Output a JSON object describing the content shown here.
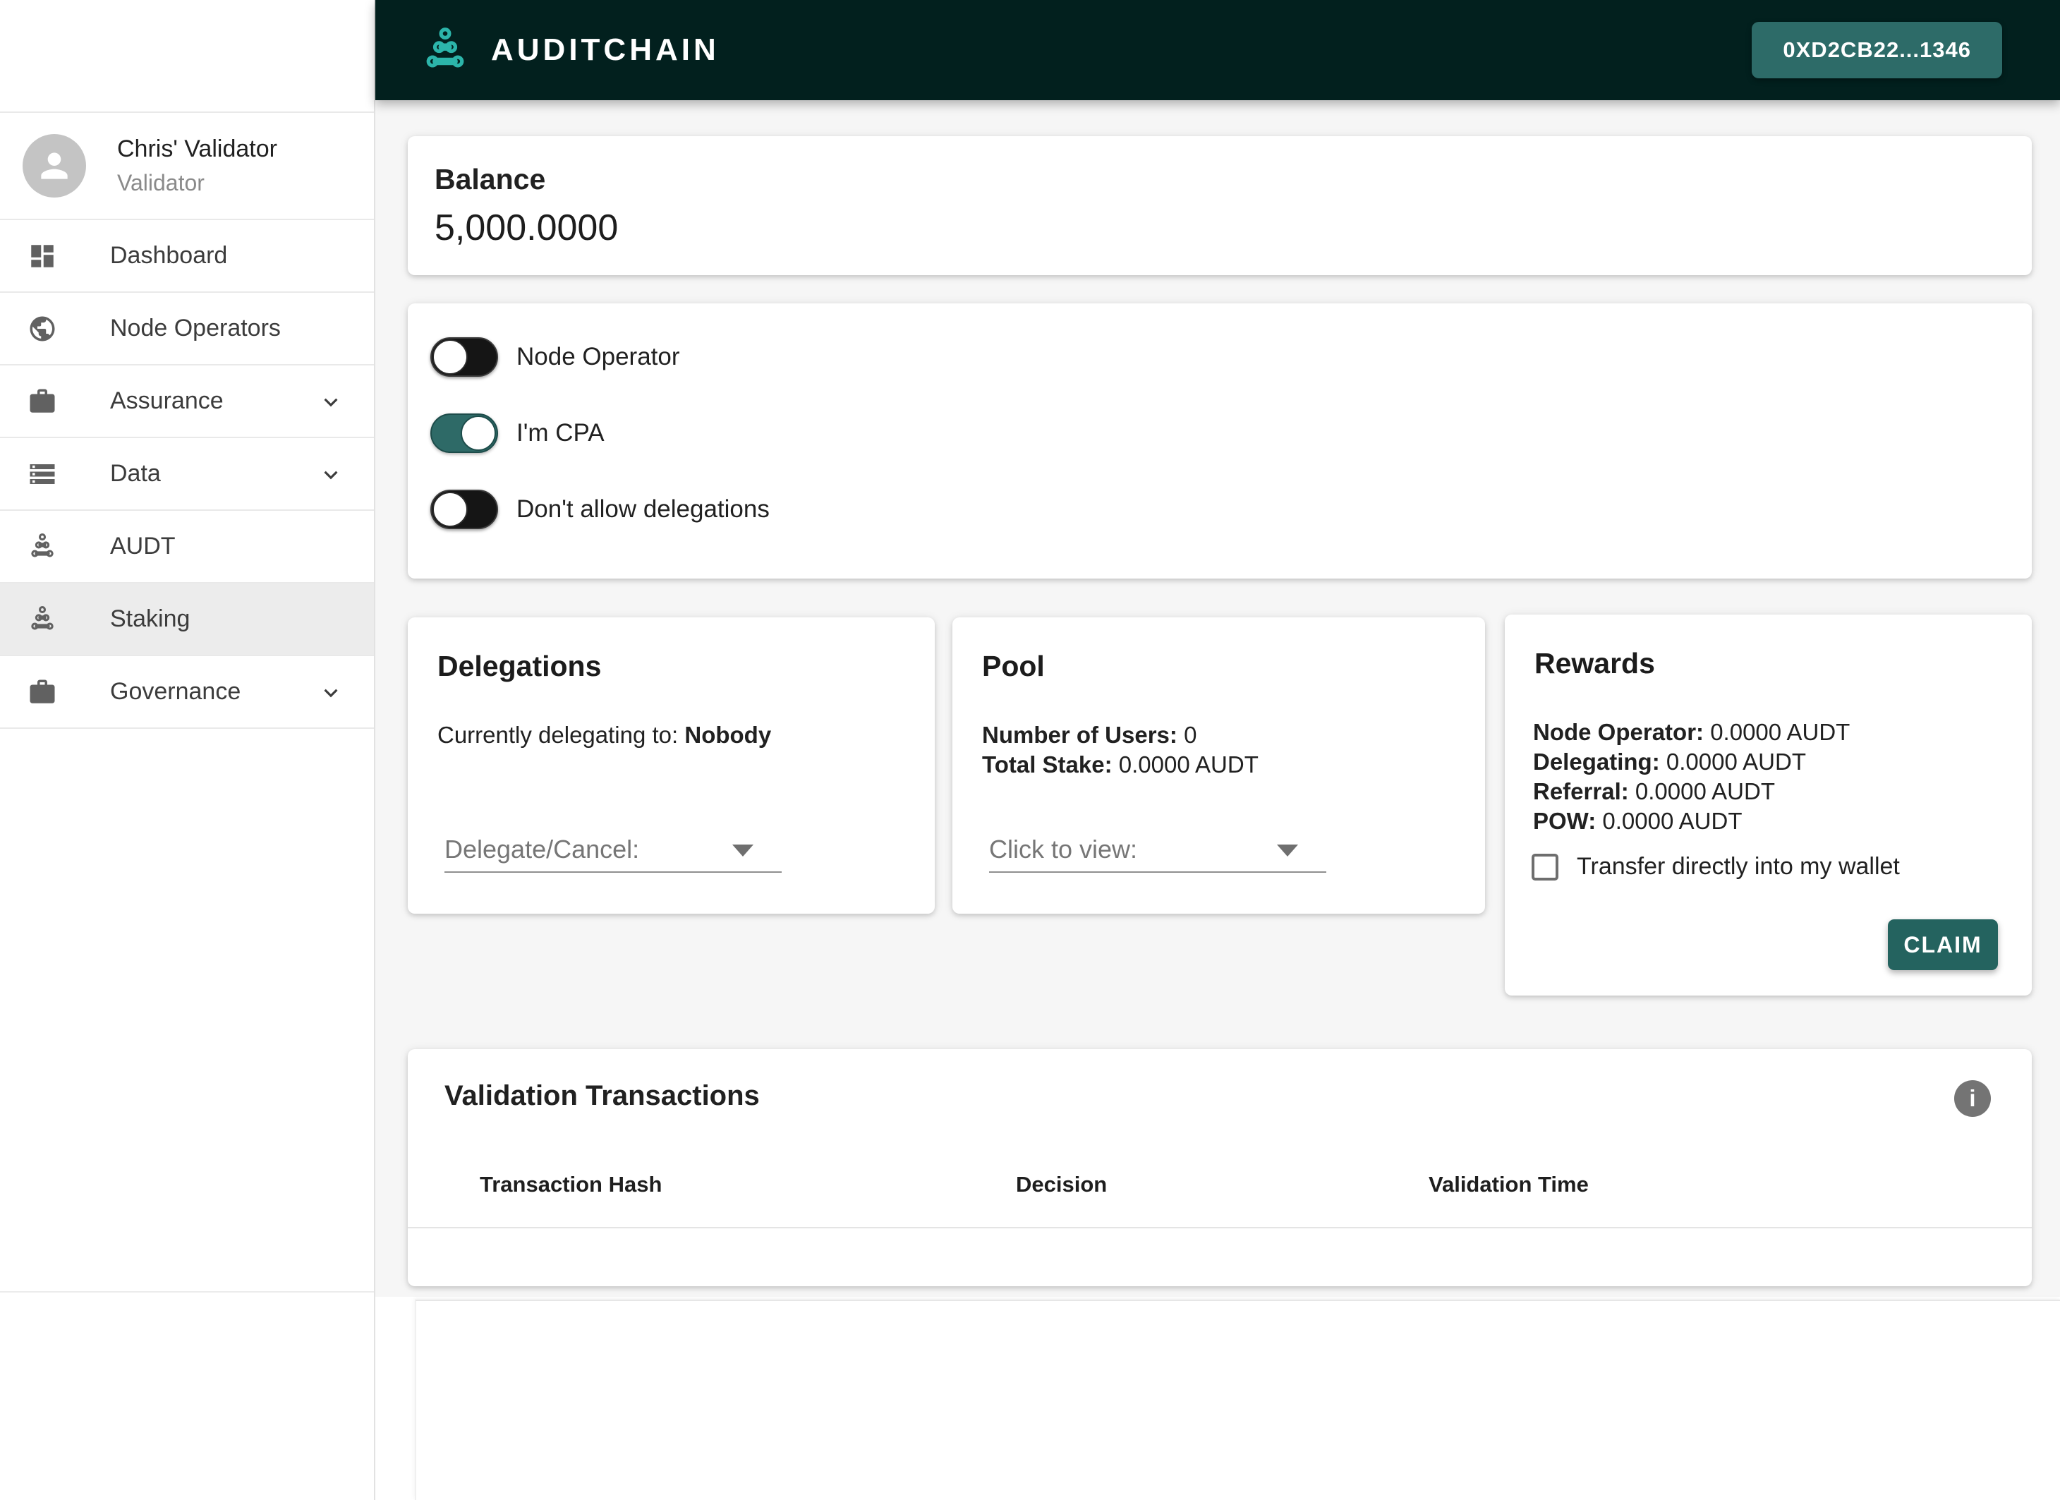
{
  "header": {
    "brand": "AUDITCHAIN",
    "wallet_button_label": "0XD2CB22...1346",
    "logo_icon": "auditchain-logo-icon",
    "colors": {
      "header_bg": "#02201e",
      "logo_teal": "#2cb5aa",
      "wallet_button": "#2d6b68"
    }
  },
  "sidebar": {
    "profile": {
      "name": "Chris' Validator",
      "role": "Validator"
    },
    "items": [
      {
        "label": "Dashboard",
        "icon": "dashboard-icon",
        "expandable": false,
        "selected": false
      },
      {
        "label": "Node Operators",
        "icon": "globe-icon",
        "expandable": false,
        "selected": false
      },
      {
        "label": "Assurance",
        "icon": "briefcase-icon",
        "expandable": true,
        "selected": false
      },
      {
        "label": "Data",
        "icon": "storage-icon",
        "expandable": true,
        "selected": false
      },
      {
        "label": "AUDT",
        "icon": "auditchain-icon",
        "expandable": false,
        "selected": false
      },
      {
        "label": "Staking",
        "icon": "auditchain-icon",
        "expandable": false,
        "selected": true
      },
      {
        "label": "Governance",
        "icon": "briefcase-icon",
        "expandable": true,
        "selected": false
      }
    ]
  },
  "balance": {
    "title": "Balance",
    "value": "5,000.0000"
  },
  "settings": {
    "toggles": [
      {
        "label": "Node Operator",
        "on": false
      },
      {
        "label": "I'm CPA",
        "on": true
      },
      {
        "label": "Don't allow delegations",
        "on": false
      }
    ]
  },
  "delegations": {
    "title": "Delegations",
    "status_label": "Currently delegating to: ",
    "status_value": "Nobody",
    "dropdown_label": "Delegate/Cancel:"
  },
  "pool": {
    "title": "Pool",
    "users_label": "Number of Users: ",
    "users_value": "0",
    "stake_label": "Total Stake: ",
    "stake_value": "0.0000 AUDT",
    "dropdown_label": "Click to view:"
  },
  "rewards": {
    "title": "Rewards",
    "rows": [
      {
        "label": "Node Operator: ",
        "value": "0.0000 AUDT"
      },
      {
        "label": "Delegating: ",
        "value": "0.0000 AUDT"
      },
      {
        "label": "Referral: ",
        "value": "0.0000 AUDT"
      },
      {
        "label": "POW: ",
        "value": "0.0000 AUDT"
      }
    ],
    "checkbox_label": "Transfer directly into my wallet",
    "checkbox_checked": false,
    "claim_label": "CLAIM",
    "claim_color": "#24635f"
  },
  "transactions": {
    "title": "Validation Transactions",
    "columns": [
      "Transaction Hash",
      "Decision",
      "Validation Time"
    ],
    "rows": []
  }
}
